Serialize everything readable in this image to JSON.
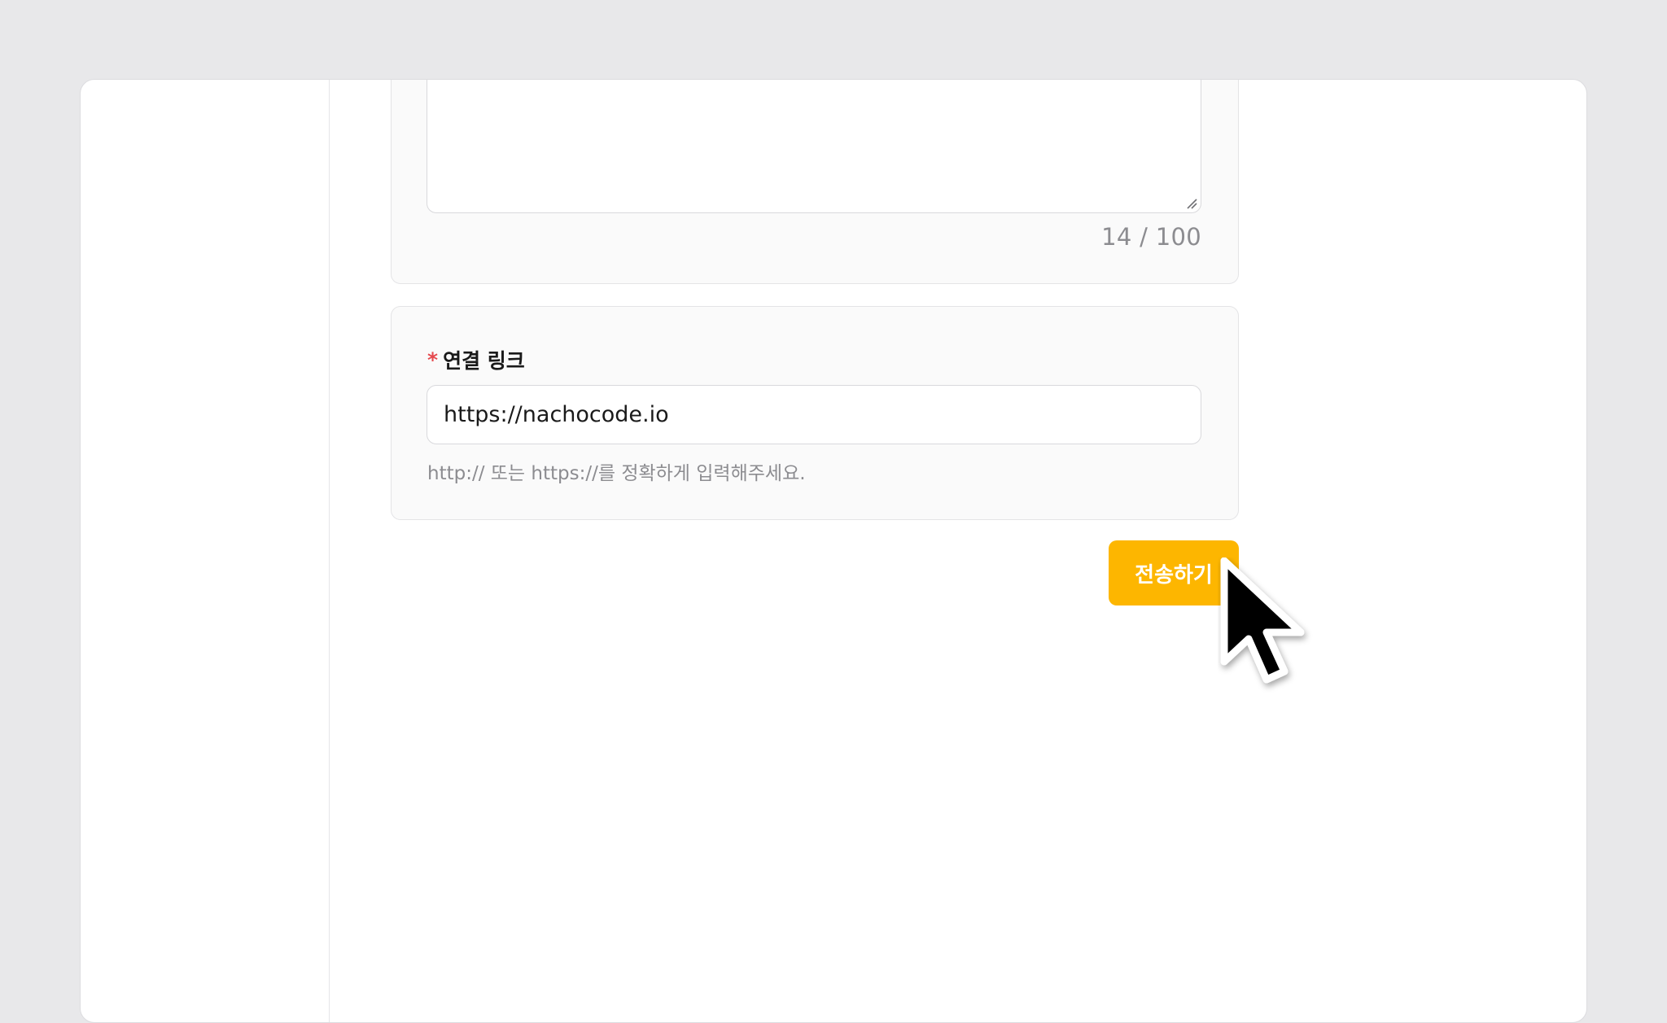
{
  "description_field": {
    "char_count": "14 / 100"
  },
  "link_field": {
    "required_mark": "*",
    "label": "연결 링크",
    "value": "https://nachocode.io",
    "helper": "http:// 또는 https://를 정확하게 입력해주세요."
  },
  "actions": {
    "submit_label": "전송하기"
  },
  "colors": {
    "accent": "#fdb600",
    "required": "#e5484d"
  },
  "icons": {
    "cursor": "mouse-pointer-icon",
    "resize": "resize-grip-icon"
  }
}
